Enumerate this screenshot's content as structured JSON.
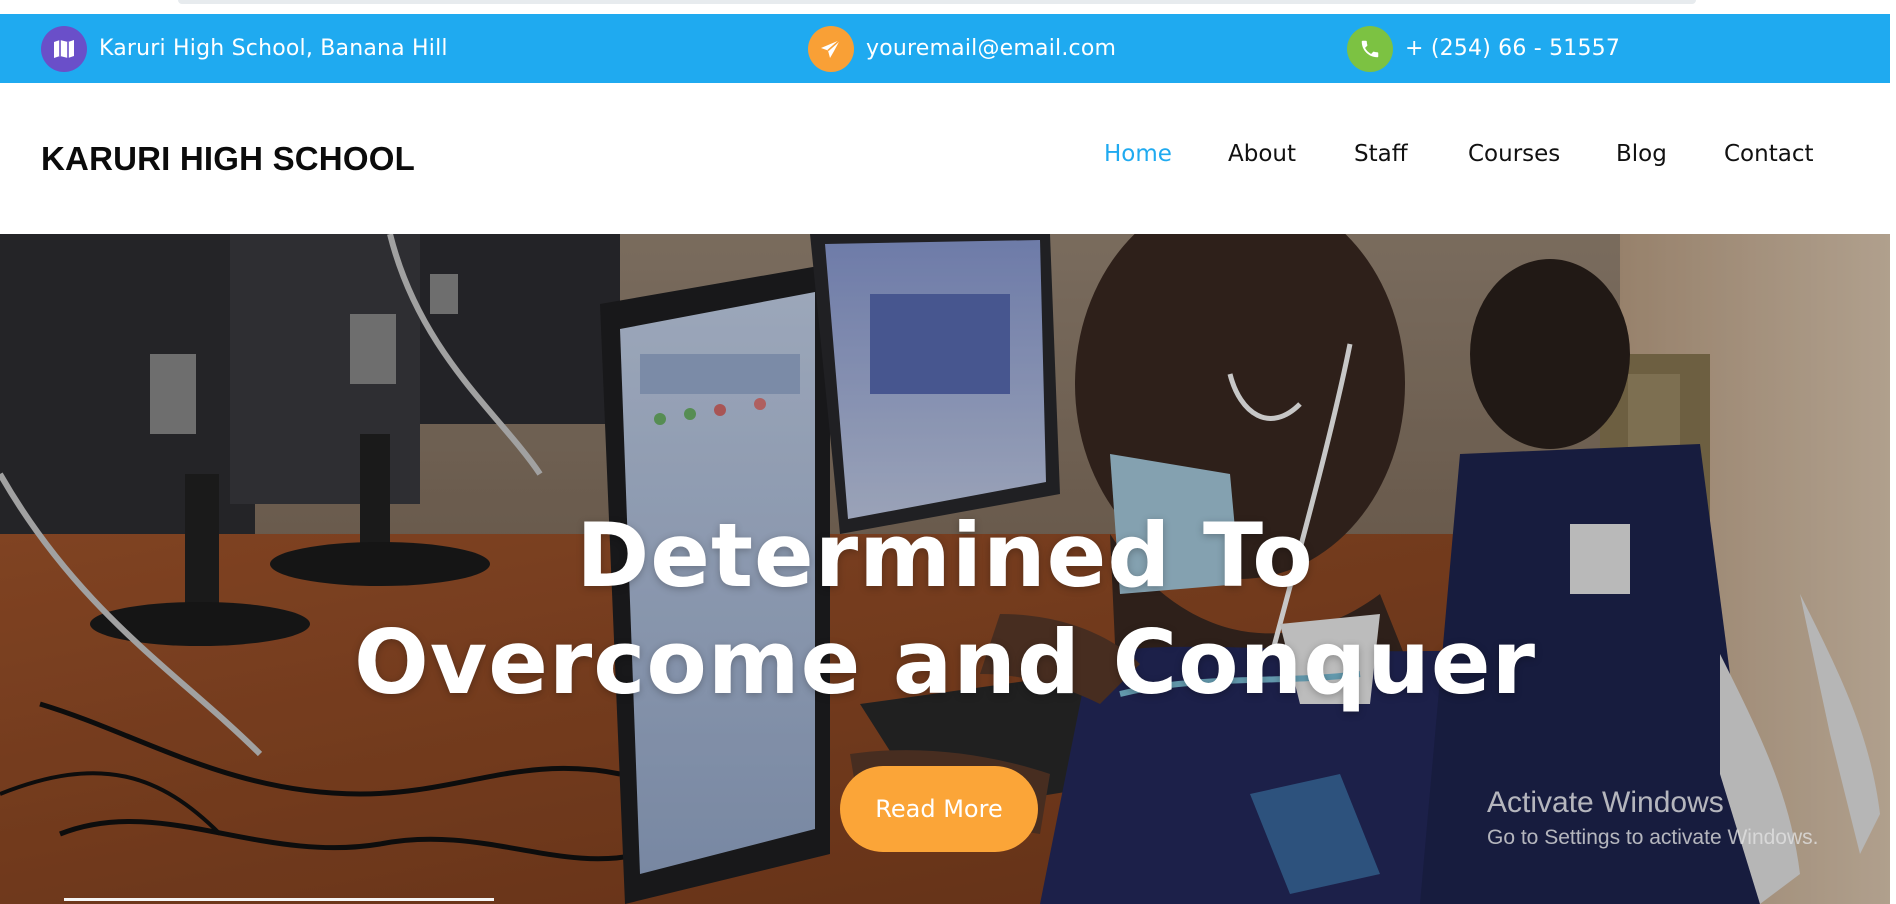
{
  "topbar": {
    "address": {
      "icon": "map-icon",
      "text": "Karuri High School, Banana Hill",
      "color": "#6a4fc9"
    },
    "email": {
      "icon": "paper-plane-icon",
      "text": "youremail@email.com",
      "color": "#f9a036"
    },
    "phone": {
      "icon": "phone-icon",
      "text": "+ (254) 66 - 51557",
      "color": "#7cc242"
    },
    "background": "#1faaf0"
  },
  "header": {
    "brand": "KARURI HIGH SCHOOL",
    "nav": [
      {
        "label": "Home",
        "active": true
      },
      {
        "label": "About",
        "active": false
      },
      {
        "label": "Staff",
        "active": false
      },
      {
        "label": "Courses",
        "active": false
      },
      {
        "label": "Blog",
        "active": false
      },
      {
        "label": "Contact",
        "active": false
      }
    ]
  },
  "hero": {
    "title_line1": "Determined To",
    "title_line2": "Overcome and Conquer",
    "button_label": "Read More",
    "button_color": "#fba538"
  },
  "watermark": {
    "title": "Activate Windows",
    "subtitle": "Go to Settings to activate Windows."
  }
}
